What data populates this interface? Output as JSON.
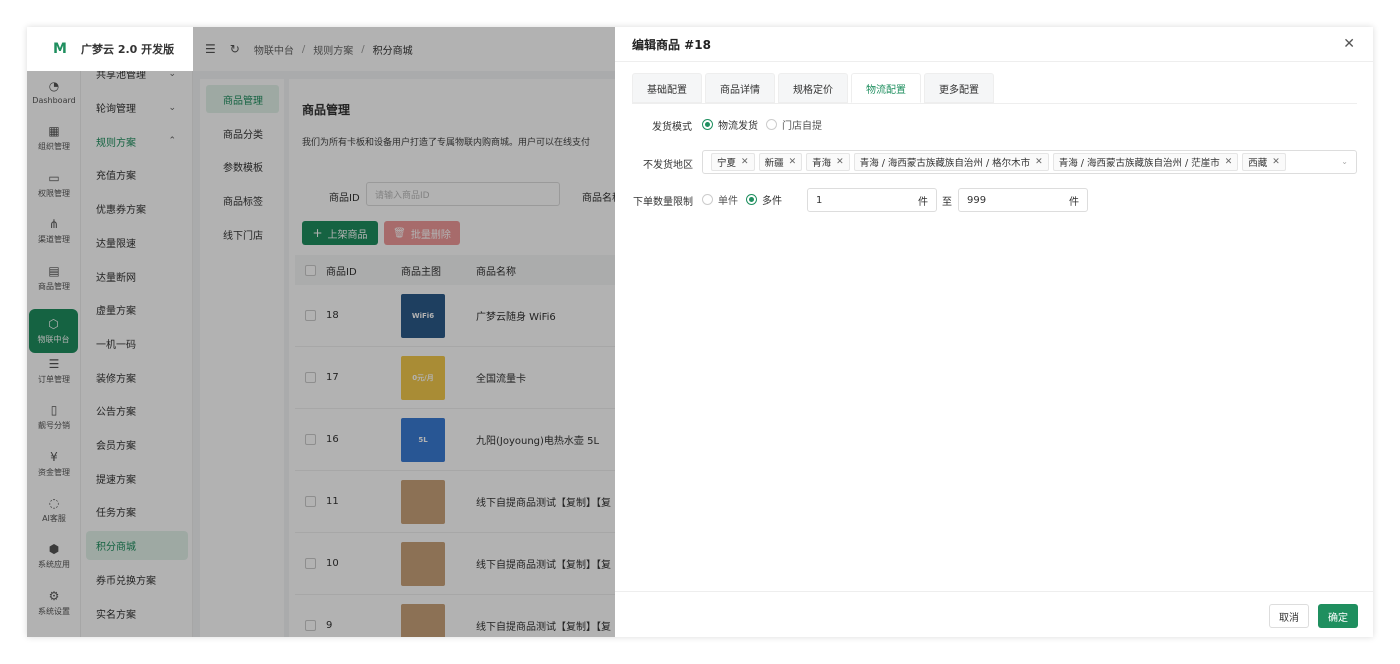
{
  "app": {
    "title": "广梦云 2.0 开发版",
    "logo": "M"
  },
  "rail": [
    {
      "label": "Dashboard",
      "icon": "dashboard-icon",
      "glyph": "◔"
    },
    {
      "label": "组织管理",
      "icon": "grid-icon",
      "glyph": "▦"
    },
    {
      "label": "权限管理",
      "icon": "monitor-icon",
      "glyph": "▭"
    },
    {
      "label": "渠道管理",
      "icon": "network-icon",
      "glyph": "⋔"
    },
    {
      "label": "商品管理",
      "icon": "store-icon",
      "glyph": "▤"
    },
    {
      "label": "物联中台",
      "icon": "iot-icon",
      "glyph": "⬡"
    },
    {
      "label": "订单管理",
      "icon": "list-icon",
      "glyph": "☰"
    },
    {
      "label": "靓号分销",
      "icon": "phone-icon",
      "glyph": "▯"
    },
    {
      "label": "资金管理",
      "icon": "yuan-icon",
      "glyph": "¥"
    },
    {
      "label": "AI客服",
      "icon": "chat-icon",
      "glyph": "◌"
    },
    {
      "label": "系统应用",
      "icon": "cube-icon",
      "glyph": "⬢"
    },
    {
      "label": "系统设置",
      "icon": "gear-icon",
      "glyph": "⚙"
    }
  ],
  "submenu": [
    {
      "label": "共享池管理",
      "chev": "⌄"
    },
    {
      "label": "轮询管理",
      "chev": "⌄"
    },
    {
      "label": "规则方案",
      "chev": "⌃"
    },
    {
      "label": "充值方案"
    },
    {
      "label": "优惠券方案"
    },
    {
      "label": "达量限速"
    },
    {
      "label": "达量断网"
    },
    {
      "label": "虚量方案"
    },
    {
      "label": "一机一码"
    },
    {
      "label": "装修方案"
    },
    {
      "label": "公告方案"
    },
    {
      "label": "会员方案"
    },
    {
      "label": "提速方案"
    },
    {
      "label": "任务方案"
    },
    {
      "label": "积分商城"
    },
    {
      "label": "券币兑换方案"
    },
    {
      "label": "实名方案"
    }
  ],
  "breadcrumb": [
    "物联中台",
    "规则方案",
    "积分商城"
  ],
  "categories": [
    "商品管理",
    "商品分类",
    "参数模板",
    "商品标签",
    "线下门店"
  ],
  "main": {
    "title": "商品管理",
    "desc": "我们为所有卡板和设备用户打造了专属物联内购商城。用户可以在线支付",
    "filter_id_label": "商品ID",
    "filter_id_placeholder": "请输入商品ID",
    "filter_name_label": "商品名称",
    "btn_add": "上架商品",
    "btn_del": "批量删除",
    "columns": [
      "商品ID",
      "商品主图",
      "商品名称"
    ],
    "rows": [
      {
        "id": "18",
        "name": "广梦云随身 WiFi6",
        "thumb_color": "#2b5b8a",
        "thumb_text": "WiFi6"
      },
      {
        "id": "17",
        "name": "全国流量卡",
        "thumb_color": "#f2c94c",
        "thumb_text": "0元/月"
      },
      {
        "id": "16",
        "name": "九阳(Joyoung)电热水壶 5L",
        "thumb_color": "#3a7bd5",
        "thumb_text": "5L"
      },
      {
        "id": "11",
        "name": "线下自提商品测试【复制】【复",
        "thumb_color": "#c9a27a",
        "thumb_text": ""
      },
      {
        "id": "10",
        "name": "线下自提商品测试【复制】【复",
        "thumb_color": "#c9a27a",
        "thumb_text": ""
      },
      {
        "id": "9",
        "name": "线下自提商品测试【复制】【复",
        "thumb_color": "#c9a27a",
        "thumb_text": ""
      }
    ]
  },
  "drawer": {
    "title": "编辑商品 #18",
    "tabs": [
      "基础配置",
      "商品详情",
      "规格定价",
      "物流配置",
      "更多配置"
    ],
    "active_tab": "物流配置",
    "ship_mode_label": "发货模式",
    "ship_modes": [
      "物流发货",
      "门店自提"
    ],
    "ship_mode_selected": "物流发货",
    "no_ship_label": "不发货地区",
    "no_ship_regions": [
      "宁夏",
      "新疆",
      "青海",
      "青海 / 海西蒙古族藏族自治州 / 格尔木市",
      "青海 / 海西蒙古族藏族自治州 / 茫崖市",
      "西藏"
    ],
    "qty_label": "下单数量限制",
    "qty_modes": [
      "单件",
      "多件"
    ],
    "qty_mode_selected": "多件",
    "qty_min": "1",
    "qty_max": "999",
    "qty_unit": "件",
    "qty_to": "至",
    "cancel": "取消",
    "confirm": "确定"
  },
  "colors": {
    "accent": "#1f8f5f",
    "danger": "#f09a9a"
  }
}
